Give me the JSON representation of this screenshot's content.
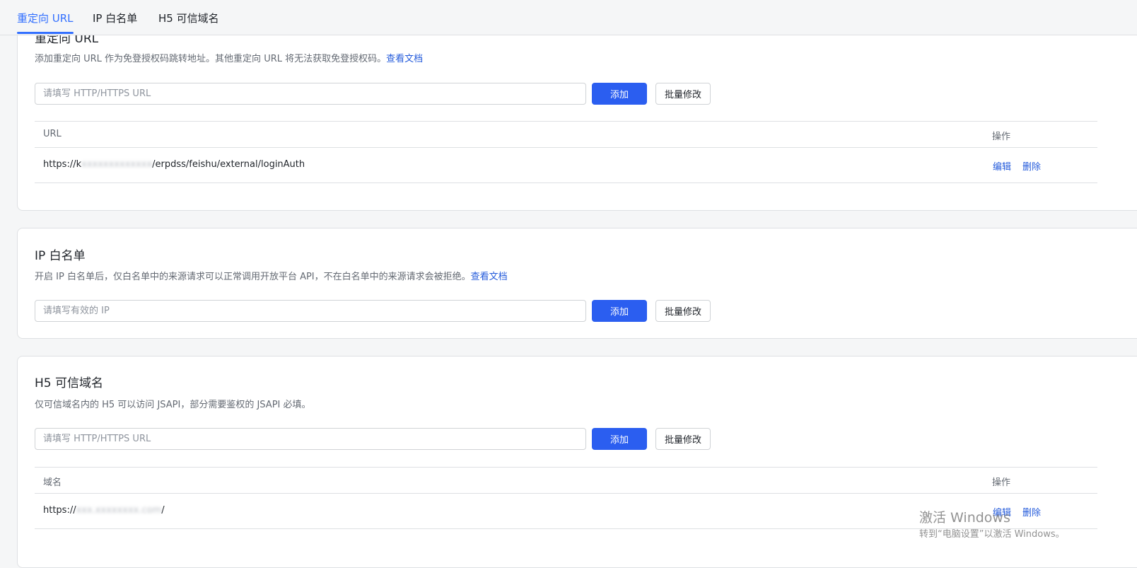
{
  "tabs": [
    {
      "label": "重定向 URL"
    },
    {
      "label": "IP 白名单"
    },
    {
      "label": "H5 可信域名"
    }
  ],
  "redirect": {
    "title": "重定向 URL",
    "description": "添加重定向 URL 作为免登授权码跳转地址。其他重定向 URL 将无法获取免登授权码。",
    "doc_link": "查看文档",
    "input_placeholder": "请填写 HTTP/HTTPS URL",
    "add_label": "添加",
    "batch_label": "批量修改",
    "columns": {
      "col1": "URL",
      "col2": "操作"
    },
    "rows": [
      {
        "prefix": "https://k",
        "masked": "xxxxxxxxxxxxx",
        "suffix": "/erpdss/feishu/external/loginAuth",
        "edit": "编辑",
        "delete": "删除"
      }
    ]
  },
  "ip_whitelist": {
    "title": "IP 白名单",
    "description": "开启 IP 白名单后，仅白名单中的来源请求可以正常调用开放平台 API，不在白名单中的来源请求会被拒绝。",
    "doc_link": "查看文档",
    "input_placeholder": "请填写有效的 IP",
    "add_label": "添加",
    "batch_label": "批量修改"
  },
  "h5_domain": {
    "title": "H5 可信域名",
    "description": "仅可信域名内的 H5 可以访问 JSAPI，部分需要鉴权的 JSAPI 必填。",
    "input_placeholder": "请填写 HTTP/HTTPS URL",
    "add_label": "添加",
    "batch_label": "批量修改",
    "columns": {
      "col1": "域名",
      "col2": "操作"
    },
    "rows": [
      {
        "prefix": "https://",
        "masked": "xxx.xxxxxxxx.com",
        "suffix": "/",
        "edit": "编辑",
        "delete": "删除"
      }
    ]
  },
  "watermark": {
    "line1": "激活 Windows",
    "line2": "转到“电脑设置”以激活 Windows。"
  },
  "colors": {
    "accent": "#3370ff",
    "primary_button": "#2b5ef0",
    "link": "#245bdb",
    "border": "#dee0e3",
    "page_bg": "#f5f6f7"
  }
}
